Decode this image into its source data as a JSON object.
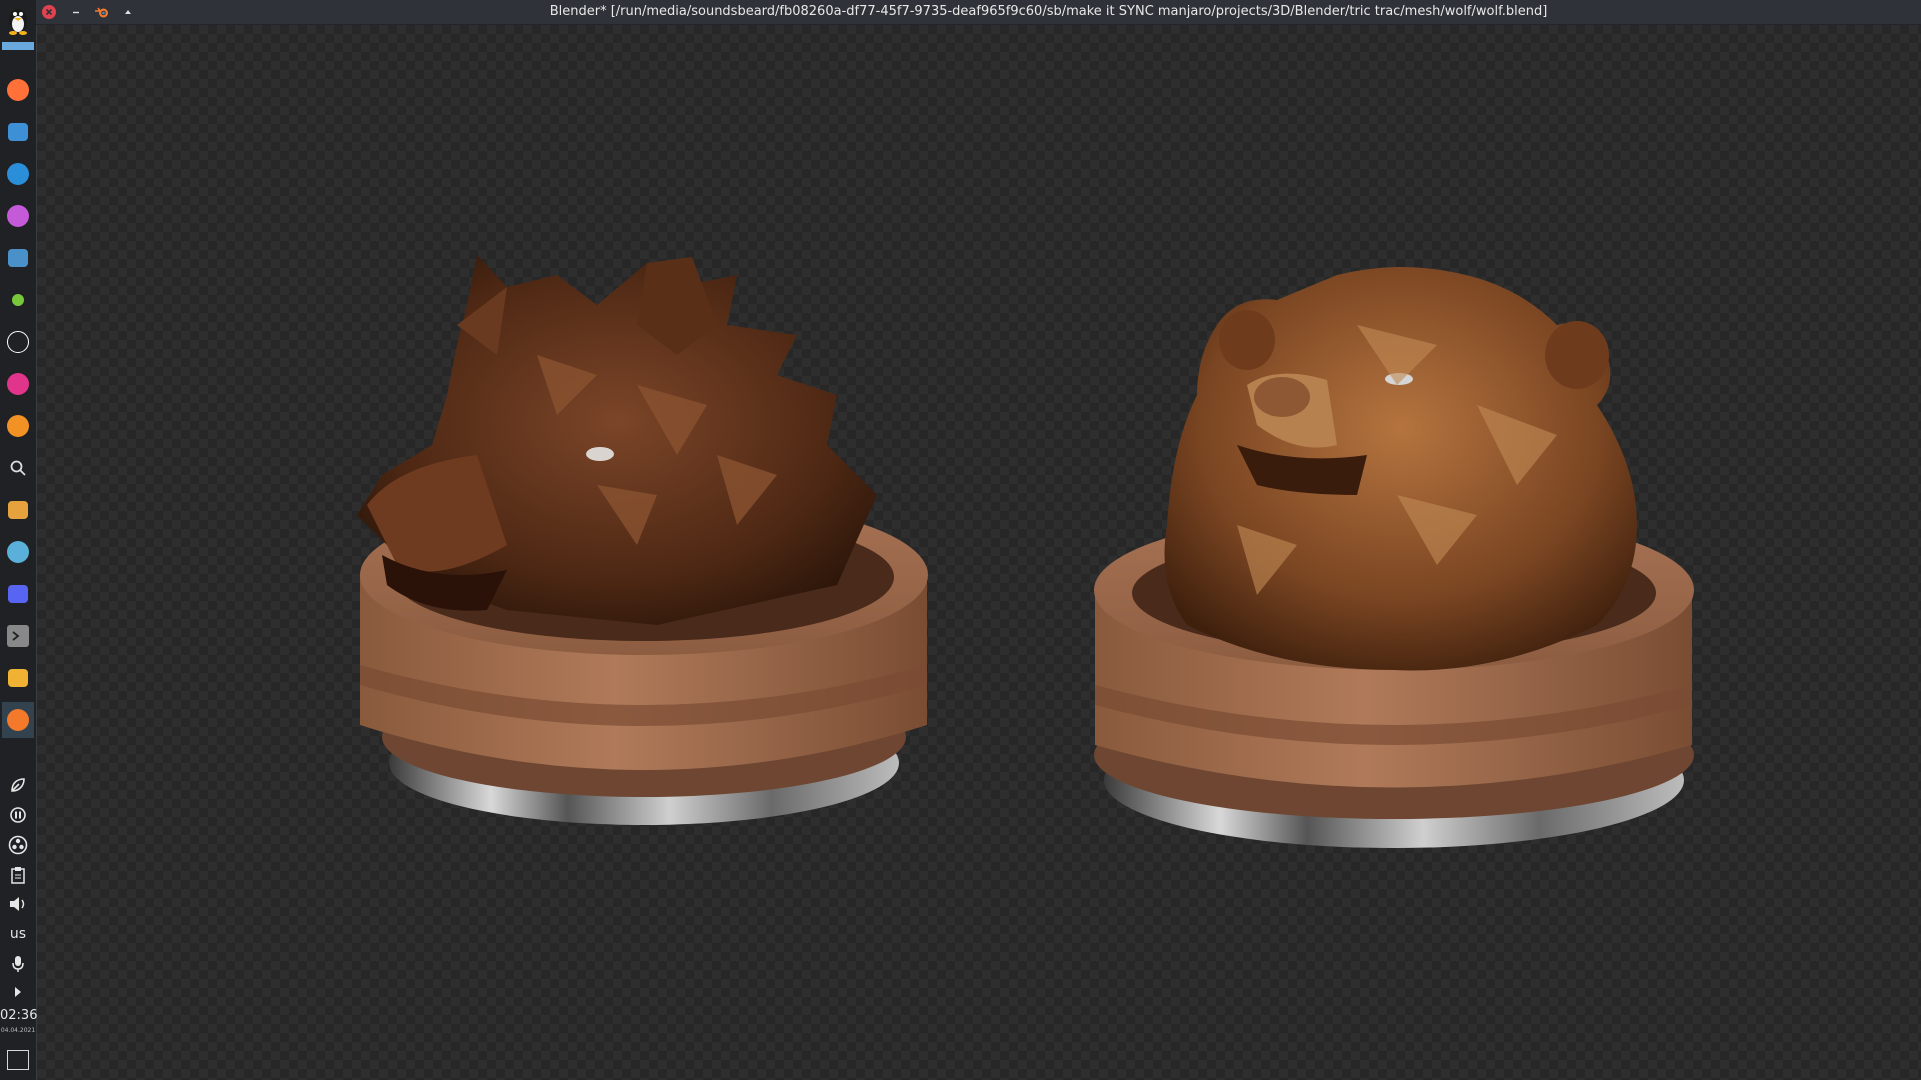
{
  "window": {
    "title": "Blender* [/run/media/soundsbeard/fb08260a-df77-45f7-9735-deaf965f9c60/sb/make it SYNC manjaro/projects/3D/Blender/tric trac/mesh/wolf/wolf.blend]",
    "app_icon": "blender-icon"
  },
  "dock": {
    "launchers": [
      {
        "name": "firefox",
        "icon": "firefox-icon",
        "color": "#ff7139"
      },
      {
        "name": "file-manager",
        "icon": "folder-icon",
        "color": "#3d8fd6"
      },
      {
        "name": "browser",
        "icon": "globe-icon",
        "color": "#2a8fd8"
      },
      {
        "name": "color-app",
        "icon": "palette-icon",
        "color": "#c45ad8"
      },
      {
        "name": "calendar",
        "icon": "calendar-icon",
        "color": "#4a90c9"
      },
      {
        "name": "green-app",
        "icon": "circle-icon",
        "color": "#78c93a"
      },
      {
        "name": "obs",
        "icon": "obs-icon",
        "color": "#ffffff"
      },
      {
        "name": "color-picker",
        "icon": "flame-icon",
        "color": "#e0358a"
      },
      {
        "name": "orange-app",
        "icon": "orange-circle-icon",
        "color": "#f29224"
      },
      {
        "name": "search",
        "icon": "search-icon",
        "color": "#dddddd"
      },
      {
        "name": "media",
        "icon": "media-icon",
        "color": "#e6a23c"
      },
      {
        "name": "inkscape",
        "icon": "star-icon",
        "color": "#5ab0d8"
      },
      {
        "name": "discord",
        "icon": "discord-icon",
        "color": "#5865f2"
      },
      {
        "name": "terminal",
        "icon": "terminal-icon",
        "color": "#888888"
      },
      {
        "name": "discord-alt",
        "icon": "chat-icon",
        "color": "#f0b232"
      },
      {
        "name": "blender",
        "icon": "blender-icon",
        "color": "#f5792a"
      }
    ],
    "tray": {
      "keyboard_layout": "us",
      "clock_time": "02:36",
      "clock_date": "04.04.2021"
    }
  },
  "viewport": {
    "objects": [
      "wolf-head-bust",
      "bear-head-bust"
    ],
    "background": "transparent-checker"
  }
}
